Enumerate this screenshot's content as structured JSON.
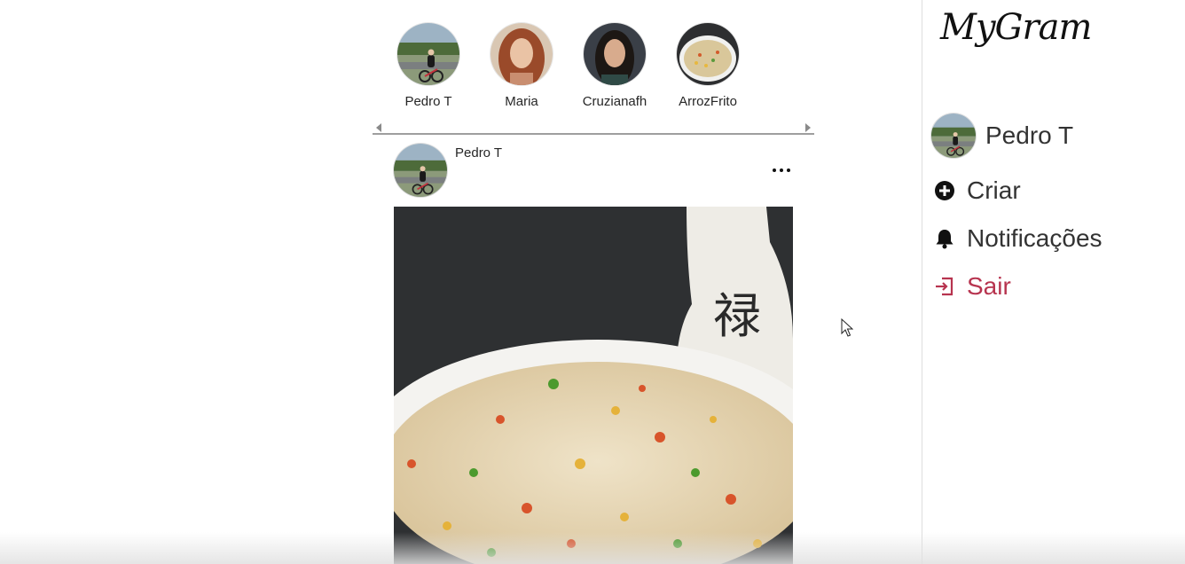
{
  "stories": [
    {
      "name": "Pedro T"
    },
    {
      "name": "Maria"
    },
    {
      "name": "Cruzianafh"
    },
    {
      "name": "ArrozFrito"
    }
  ],
  "post": {
    "author": "Pedro T",
    "image_description_icon": "fried-rice-photo"
  },
  "sidebar": {
    "logo": "MyGram",
    "profile": {
      "label": "Pedro T"
    },
    "menu": {
      "create": "Criar",
      "notifications": "Notificações",
      "logout": "Sair"
    }
  },
  "colors": {
    "accent_logout": "#b7344f",
    "text": "#333333",
    "divider": "#dedede"
  }
}
